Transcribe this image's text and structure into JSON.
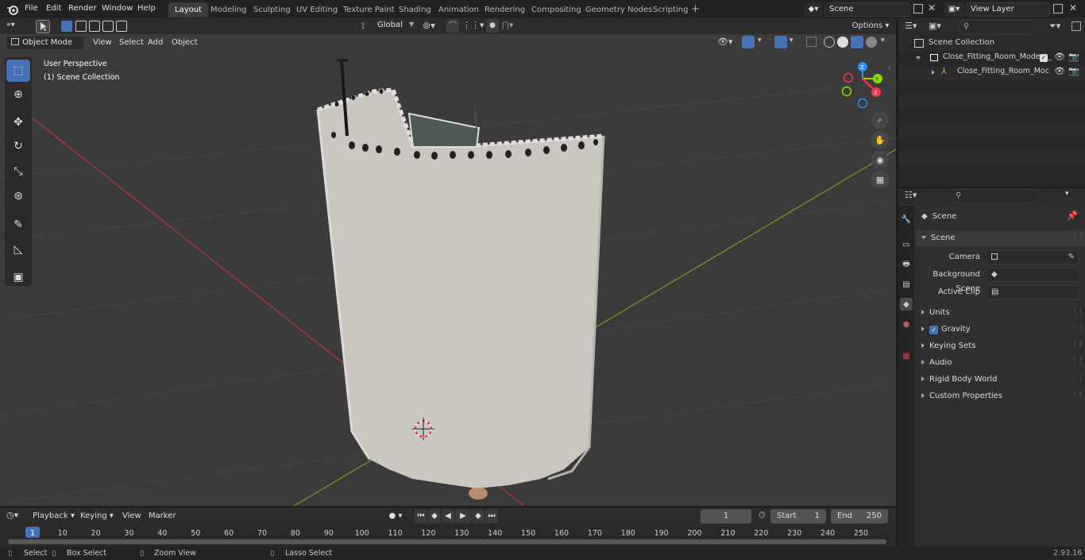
{
  "app": {
    "version": "2.93.16"
  },
  "menu": [
    "File",
    "Edit",
    "Render",
    "Window",
    "Help"
  ],
  "workspaces": [
    "Layout",
    "Modeling",
    "Sculpting",
    "UV Editing",
    "Texture Paint",
    "Shading",
    "Animation",
    "Rendering",
    "Compositing",
    "Geometry Nodes",
    "Scripting"
  ],
  "active_workspace": "Layout",
  "scene_field": "Scene",
  "view_layer_field": "View Layer",
  "viewport": {
    "mode": "Object Mode",
    "header_menus": [
      "View",
      "Select",
      "Add",
      "Object"
    ],
    "transform_orientation": "Global",
    "options_label": "Options",
    "overlay_text": [
      "User Perspective",
      "(1) Scene Collection"
    ],
    "gizmo_axes": {
      "x": "X",
      "y": "Y",
      "z": "Z"
    }
  },
  "outliner": {
    "root": "Scene Collection",
    "items": [
      {
        "label": "Close_Fitting_Room_Modern_",
        "level": 1
      },
      {
        "label": "Close_Fitting_Room_Moc",
        "level": 2
      }
    ]
  },
  "properties": {
    "context": "Scene",
    "panel_title": "Scene",
    "fields": [
      {
        "label": "Camera",
        "value": ""
      },
      {
        "label": "Background Scene",
        "value": ""
      },
      {
        "label": "Active Clip",
        "value": ""
      }
    ],
    "sections": [
      "Units",
      "Gravity",
      "Keying Sets",
      "Audio",
      "Rigid Body World",
      "Custom Properties"
    ],
    "gravity_checked": true
  },
  "timeline": {
    "menus": [
      "Playback",
      "Keying",
      "View",
      "Marker"
    ],
    "current_frame": "1",
    "start_label": "Start",
    "start": "1",
    "end_label": "End",
    "end": "250",
    "ticks": [
      "1",
      "10",
      "20",
      "30",
      "40",
      "50",
      "60",
      "70",
      "80",
      "90",
      "100",
      "110",
      "120",
      "130",
      "140",
      "150",
      "160",
      "170",
      "180",
      "190",
      "200",
      "210",
      "220",
      "230",
      "240",
      "250"
    ]
  },
  "status": {
    "select": "Select",
    "box_select": "Box Select",
    "zoom_view": "Zoom View",
    "lasso_select": "Lasso Select"
  },
  "colors": {
    "accent": "#4772b3",
    "x_axis": "#ff3352",
    "y_axis": "#8bdc00",
    "z_axis": "#2890ff",
    "viewport_bg": "#3b3b3b",
    "curtain": "#c9c7c0"
  }
}
